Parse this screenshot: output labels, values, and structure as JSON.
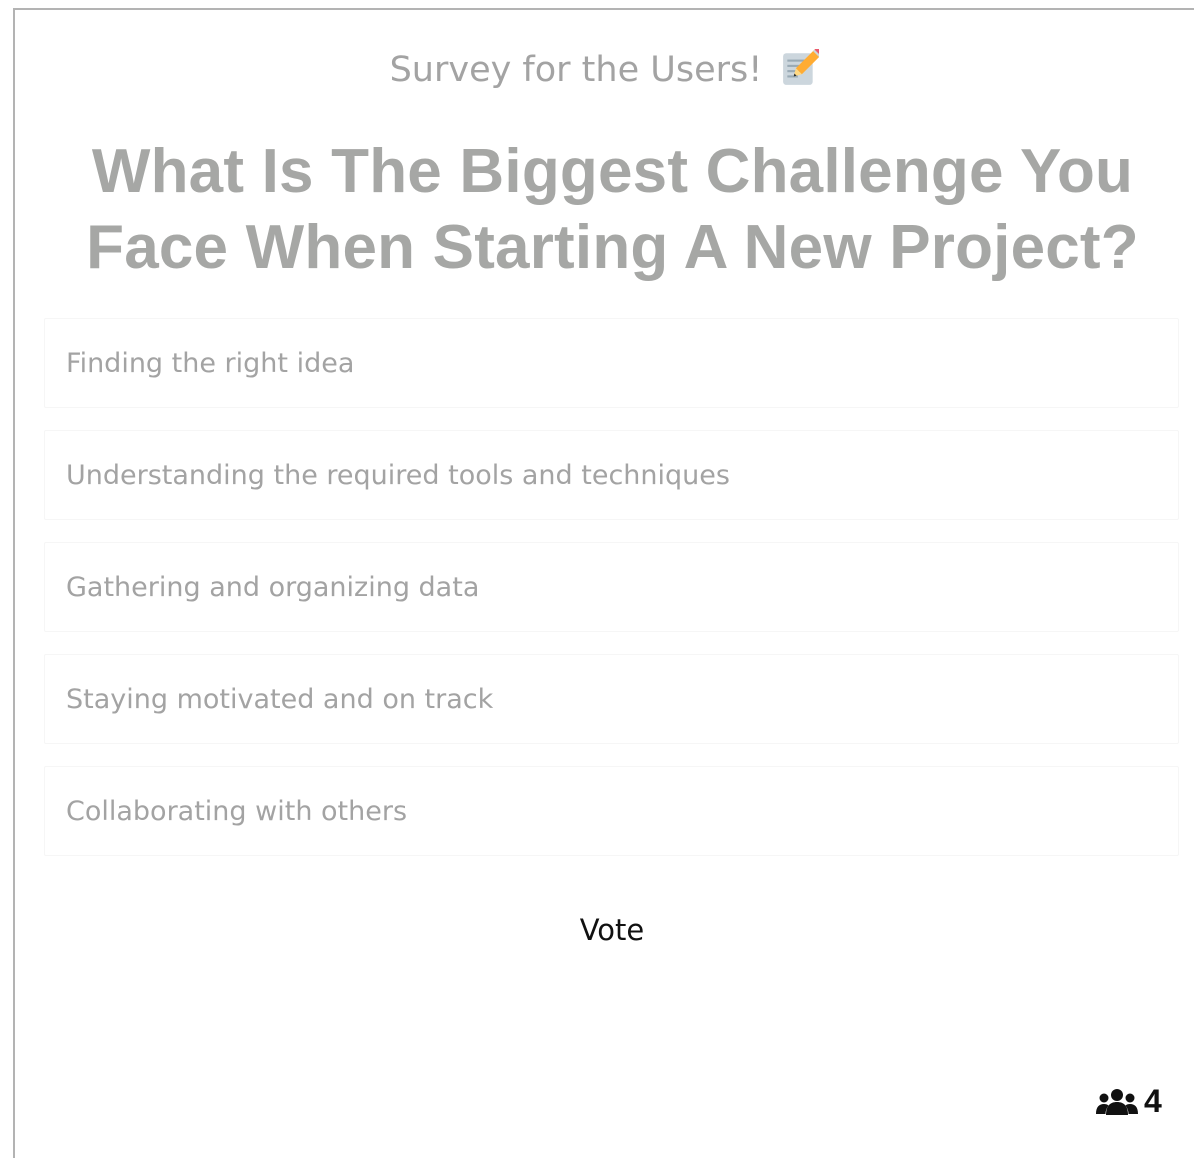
{
  "header": {
    "subtitle": "Survey for the Users!",
    "subtitle_icon": "memo-pencil-icon"
  },
  "poll": {
    "question": "What Is The Biggest Challenge You Face When Starting A New Project?",
    "options": [
      {
        "label": "Finding the right idea"
      },
      {
        "label": "Understanding the required tools and techniques"
      },
      {
        "label": "Gathering and organizing data"
      },
      {
        "label": "Staying motivated and on track"
      },
      {
        "label": "Collaborating with others"
      }
    ],
    "vote_label": "Vote"
  },
  "footer": {
    "voters_icon": "users-group-icon",
    "voters_count": "4"
  },
  "colors": {
    "muted_text": "#a3a3a3",
    "question_text": "#a6a7a5",
    "dark_text": "#111111",
    "frame_border": "#b3b3b3"
  }
}
